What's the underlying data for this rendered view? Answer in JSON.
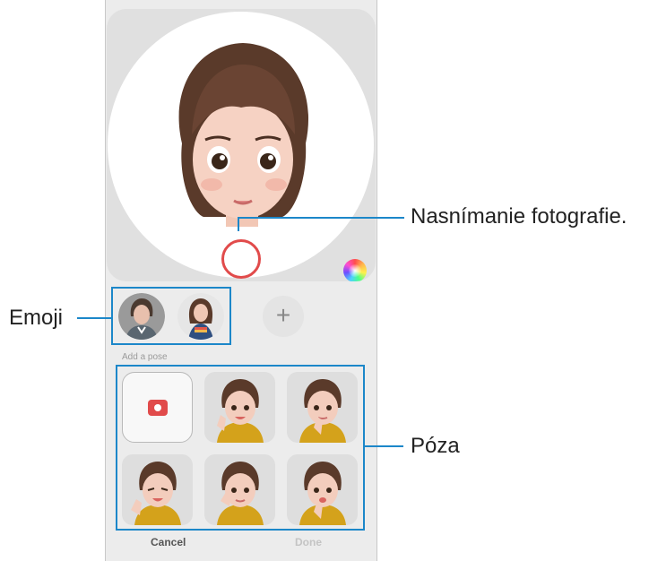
{
  "callouts": {
    "capture": "Nasnímanie fotografie.",
    "emoji": "Emoji",
    "pose": "Póza"
  },
  "phone": {
    "add_emoji_symbol": "+",
    "section_label": "Add a pose",
    "cancel_label": "Cancel",
    "done_label": "Done"
  },
  "colors": {
    "accent_highlight": "#1c87c9",
    "shutter_ring": "#e14b4b",
    "background": "#ececec"
  },
  "icons": {
    "color_palette": "color-palette-icon",
    "camera": "camera-icon",
    "plus": "plus-icon"
  }
}
